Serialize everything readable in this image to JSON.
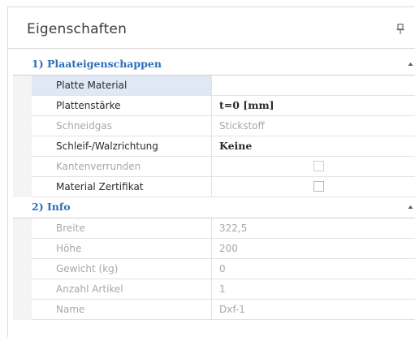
{
  "panel": {
    "title": "Eigenschaften",
    "pin_icon": "pin-icon"
  },
  "categories": [
    {
      "label": "1) Plaateigenschappen",
      "chevron": "chevron-up-icon",
      "rows": [
        {
          "name": "Platte Material",
          "value": "",
          "type": "text",
          "state": "selected"
        },
        {
          "name": "Plattenstärke",
          "value": "t=0 [mm]",
          "type": "bold",
          "state": "normal"
        },
        {
          "name": "Schneidgas",
          "value": "Stickstoff",
          "type": "text",
          "state": "disabled"
        },
        {
          "name": "Schleif-/Walzrichtung",
          "value": "Keine",
          "type": "bold",
          "state": "normal"
        },
        {
          "name": "Kantenverrunden",
          "value": "",
          "type": "checkbox",
          "checked": false,
          "state": "disabled"
        },
        {
          "name": "Material Zertifikat",
          "value": "",
          "type": "checkbox",
          "checked": false,
          "state": "normal"
        }
      ]
    },
    {
      "label": "2) Info",
      "chevron": "chevron-up-icon",
      "rows": [
        {
          "name": "Breite",
          "value": "322,5",
          "type": "text",
          "state": "disabled"
        },
        {
          "name": "Höhe",
          "value": "200",
          "type": "text",
          "state": "disabled"
        },
        {
          "name": "Gewicht (kg)",
          "value": "0",
          "type": "text",
          "state": "disabled"
        },
        {
          "name": "Anzahl Artikel",
          "value": "1",
          "type": "text",
          "state": "disabled"
        },
        {
          "name": "Name",
          "value": "Dxf-1",
          "type": "text",
          "state": "disabled"
        }
      ]
    }
  ],
  "colors": {
    "category_text": "#2a6fb8",
    "disabled_text": "#a8a8a8",
    "selected_bg": "#dfe8f4"
  }
}
